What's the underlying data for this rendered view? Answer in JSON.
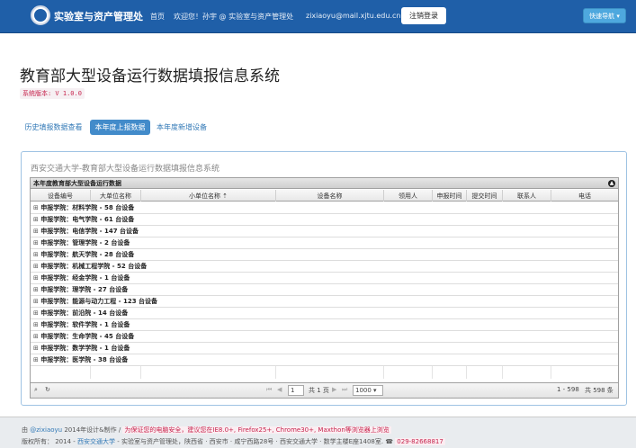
{
  "nav": {
    "brand": "实验室与资产管理处",
    "home": "首页",
    "welcome": "欢迎您！孙宇 @ 实验室与资产管理处",
    "email": "zixiaoyu@mail.xjtu.edu.cn",
    "logout": "注销登录",
    "quick_nav": "快速导航"
  },
  "page": {
    "title": "教育部大型设备运行数据填报信息系统",
    "version": "系统版本: V 1.0.0"
  },
  "tabs": [
    {
      "label": "历史填报数据查看",
      "active": false
    },
    {
      "label": "本年度上报数据",
      "active": true
    },
    {
      "label": "本年度新增设备",
      "active": false
    }
  ],
  "panel": {
    "title": "西安交通大学-教育部大型设备运行数据填报信息系统",
    "grid_caption": "本年度教育部大型设备运行数据",
    "columns": [
      "设备编号",
      "大单位名称",
      "小单位名称 ⇡",
      "设备名称",
      "领用人",
      "申报时间",
      "提交时间",
      "联系人",
      "电话"
    ],
    "rows": [
      {
        "label": "申报学院：材料学院 - 58 台设备"
      },
      {
        "label": "申报学院：电气学院 - 61 台设备"
      },
      {
        "label": "申报学院：电信学院 - 147 台设备"
      },
      {
        "label": "申报学院：管理学院 - 2 台设备"
      },
      {
        "label": "申报学院：航天学院 - 28 台设备"
      },
      {
        "label": "申报学院：机械工程学院 - 52 台设备"
      },
      {
        "label": "申报学院：经金学院 - 1 台设备"
      },
      {
        "label": "申报学院：理学院 - 27 台设备"
      },
      {
        "label": "申报学院：能源与动力工程 - 123 台设备"
      },
      {
        "label": "申报学院：前沿院 - 14 台设备"
      },
      {
        "label": "申报学院：软件学院 - 1 台设备"
      },
      {
        "label": "申报学院：生命学院 - 45 台设备"
      },
      {
        "label": "申报学院：数学学院 - 1 台设备"
      },
      {
        "label": "申报学院：医学院 - 38 台设备"
      }
    ],
    "pager": {
      "page_value": "1",
      "total_pages": "共 1 页",
      "rows_per_page": "1000",
      "range": "1 - 598",
      "total": "共 598 条"
    }
  },
  "footer": {
    "by": "由",
    "author": "@zixiaoyu",
    "design": "2014年设计&制作 /",
    "warning": "为保证您的电脑安全，建议您在IE8.0+, Firefox25+, Chrome30+, Maxthon等浏览器上浏览",
    "copyright_prefix": "版权所有： 2014 -",
    "university": "西安交通大学",
    "copyright_rest": "- 实验室与资产管理处，陕西省 · 西安市 · 咸宁西路28号 · 西安交通大学 · 数学主楼E座1408室.",
    "phone_icon": "☎",
    "phone": "029-82668817"
  },
  "colors": {
    "navbar": "#1f5fa8",
    "accent": "#428bca",
    "warning": "#c7254e"
  }
}
